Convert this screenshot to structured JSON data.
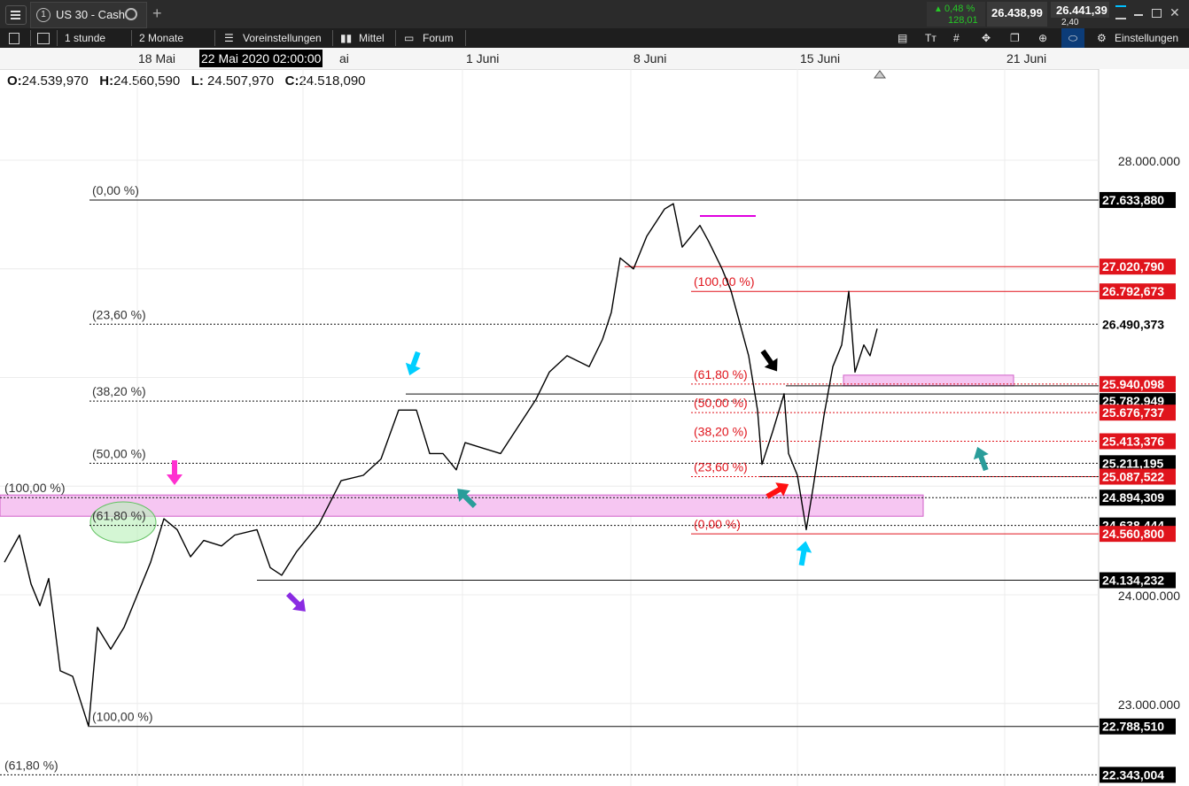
{
  "instrument": {
    "number": "1",
    "name": "US 30 - Cash"
  },
  "quote": {
    "change_pct": "0,48 %",
    "change_abs": "128,01",
    "bid": "26.438,99",
    "ask": "26.441,39",
    "spread": "2,40"
  },
  "toolbar": {
    "interval": "1 stunde",
    "range": "2 Monate",
    "presets": "Voreinstellungen",
    "type": "Mittel",
    "forum": "Forum",
    "settings": "Einstellungen"
  },
  "dates": {
    "d1": "18 Mai",
    "crosshair": "22 Mai 2020 02:00:00",
    "d2": "ai",
    "d3": "1 Juni",
    "d4": "8 Juni",
    "d5": "15 Juni",
    "d6": "21 Juni"
  },
  "ohlc": {
    "o_label": "O:",
    "o": "24.539,970",
    "h_label": "H:",
    "h": "24.560,590",
    "l_label": "L:",
    "l": "24.507,970",
    "c_label": "C:",
    "c": "24.518,090"
  },
  "colors": {
    "bg": "#ffffff",
    "candle": "#000000",
    "fib_red": "#e0141c",
    "zone": "#f6c6f2",
    "accent": "#00d0ff"
  },
  "chart_data": {
    "type": "line",
    "ylim": [
      22300000,
      28700000
    ],
    "y_ticks": [
      "28.000.000",
      "24.000.000",
      "23.000.000"
    ],
    "y_tick_values": [
      28000000,
      24000000,
      23000000
    ],
    "hidden_ticks": [
      27000000,
      26000000,
      25000000
    ],
    "price_labels": [
      {
        "value": 27633880,
        "text": "27.633,880",
        "style": "black"
      },
      {
        "value": 27020790,
        "text": "27.020,790",
        "style": "red"
      },
      {
        "value": 26792673,
        "text": "26.792,673",
        "style": "red"
      },
      {
        "value": 26490373,
        "text": "26.490,373",
        "style": "white"
      },
      {
        "value": 25940098,
        "text": "25.940,098",
        "style": "red"
      },
      {
        "value": 25782949,
        "text": "25.782,949",
        "style": "black"
      },
      {
        "value": 25676737,
        "text": "25.676,737",
        "style": "red"
      },
      {
        "value": 25413376,
        "text": "25.413,376",
        "style": "red"
      },
      {
        "value": 25211195,
        "text": "25.211,195",
        "style": "black"
      },
      {
        "value": 25087522,
        "text": "25.087,522",
        "style": "red"
      },
      {
        "value": 24894309,
        "text": "24.894,309",
        "style": "black"
      },
      {
        "value": 24638444,
        "text": "24.638,444",
        "style": "black"
      },
      {
        "value": 24560800,
        "text": "24.560,800",
        "style": "red"
      },
      {
        "value": 24134232,
        "text": "24.134,232",
        "style": "black"
      },
      {
        "value": 22788510,
        "text": "22.788,510",
        "style": "black"
      },
      {
        "value": 22343004,
        "text": "22.343,004",
        "style": "black"
      }
    ],
    "fib_black": [
      {
        "label": "(0,00 %)",
        "value": 27633880
      },
      {
        "label": "(23,60 %)",
        "value": 26490373
      },
      {
        "label": "(38,20 %)",
        "value": 25782949
      },
      {
        "label": "(50,00 %)",
        "value": 25211195
      },
      {
        "label": "(61,80 %)",
        "value": 24638444
      },
      {
        "label": "(100,00 %)",
        "value": 22788510
      }
    ],
    "fib_black_left": [
      {
        "label": "(100,00 %)",
        "value": 24894309
      },
      {
        "label": "(61,80 %)",
        "value": 22343004
      }
    ],
    "fib_red": [
      {
        "label": "(100,00 %)",
        "value": 26792673
      },
      {
        "label": "(61,80 %)",
        "value": 25940098
      },
      {
        "label": "(50,00 %)",
        "value": 25676737
      },
      {
        "label": "(38,20 %)",
        "value": 25413376
      },
      {
        "label": "(23,60 %)",
        "value": 25087522
      },
      {
        "label": "(0,00 %)",
        "value": 24560800
      }
    ],
    "price_path": [
      [
        5,
        24300000
      ],
      [
        22,
        24550000
      ],
      [
        35,
        24100000
      ],
      [
        45,
        23900000
      ],
      [
        55,
        24150000
      ],
      [
        68,
        23300000
      ],
      [
        82,
        23250000
      ],
      [
        100,
        22788510
      ],
      [
        110,
        23700000
      ],
      [
        125,
        23500000
      ],
      [
        140,
        23700000
      ],
      [
        155,
        24000000
      ],
      [
        170,
        24300000
      ],
      [
        185,
        24700000
      ],
      [
        200,
        24600000
      ],
      [
        215,
        24350000
      ],
      [
        230,
        24500000
      ],
      [
        250,
        24450000
      ],
      [
        265,
        24550000
      ],
      [
        290,
        24600000
      ],
      [
        305,
        24250000
      ],
      [
        318,
        24180000
      ],
      [
        335,
        24400000
      ],
      [
        360,
        24650000
      ],
      [
        385,
        25050000
      ],
      [
        410,
        25100000
      ],
      [
        430,
        25250000
      ],
      [
        450,
        25700000
      ],
      [
        470,
        25700000
      ],
      [
        485,
        25300000
      ],
      [
        500,
        25300000
      ],
      [
        515,
        25150000
      ],
      [
        525,
        25400000
      ],
      [
        545,
        25350000
      ],
      [
        565,
        25300000
      ],
      [
        585,
        25550000
      ],
      [
        605,
        25800000
      ],
      [
        620,
        26050000
      ],
      [
        640,
        26200000
      ],
      [
        665,
        26100000
      ],
      [
        680,
        26350000
      ],
      [
        690,
        26600000
      ],
      [
        700,
        27100000
      ],
      [
        715,
        27000000
      ],
      [
        730,
        27300000
      ],
      [
        750,
        27550000
      ],
      [
        760,
        27600000
      ],
      [
        770,
        27200000
      ],
      [
        790,
        27400000
      ],
      [
        800,
        27250000
      ],
      [
        815,
        27000000
      ],
      [
        825,
        26800000
      ],
      [
        835,
        26500000
      ],
      [
        845,
        26200000
      ],
      [
        855,
        25700000
      ],
      [
        860,
        25200000
      ],
      [
        872,
        25500000
      ],
      [
        885,
        25850000
      ],
      [
        890,
        25300000
      ],
      [
        900,
        25100000
      ],
      [
        910,
        24600000
      ],
      [
        918,
        25000000
      ],
      [
        930,
        25650000
      ],
      [
        940,
        26100000
      ],
      [
        950,
        26300000
      ],
      [
        958,
        26792673
      ],
      [
        965,
        26050000
      ],
      [
        975,
        26300000
      ],
      [
        982,
        26200000
      ],
      [
        990,
        26450000
      ]
    ]
  }
}
